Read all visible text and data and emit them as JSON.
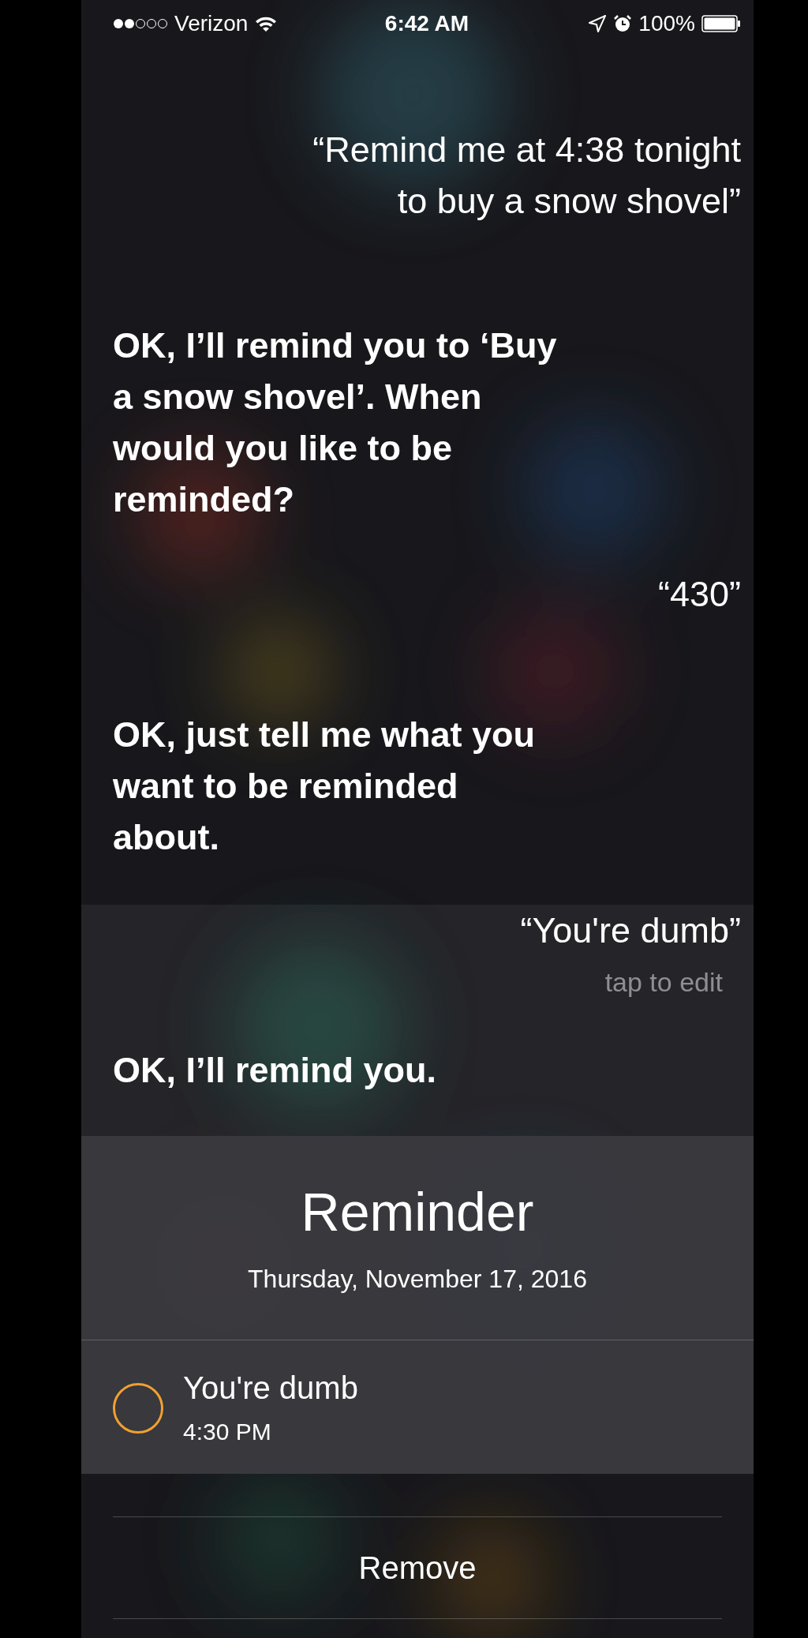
{
  "status_bar": {
    "carrier": "Verizon",
    "time": "6:42 AM",
    "battery": "100%"
  },
  "conversation": [
    {
      "kind": "user",
      "text": "“Remind me at 4:38 tonight\nto buy a snow shovel”"
    },
    {
      "kind": "siri",
      "text": "OK, I’ll remind you to ‘Buy\na snow shovel’. When\nwould you like to be\nreminded?"
    },
    {
      "kind": "user",
      "text": "“430”"
    },
    {
      "kind": "siri",
      "text": "OK, just tell me what you\nwant to be reminded\nabout."
    },
    {
      "kind": "user",
      "text": "“You're dumb”",
      "edit_hint": "tap to edit"
    },
    {
      "kind": "siri",
      "text": "OK, I’ll remind you."
    }
  ],
  "reminder": {
    "title": "Reminder",
    "date": "Thursday, November 17, 2016",
    "items": [
      {
        "title": "You're dumb",
        "time": "4:30 PM",
        "completed": false
      }
    ]
  },
  "actions": [
    "Remove"
  ]
}
